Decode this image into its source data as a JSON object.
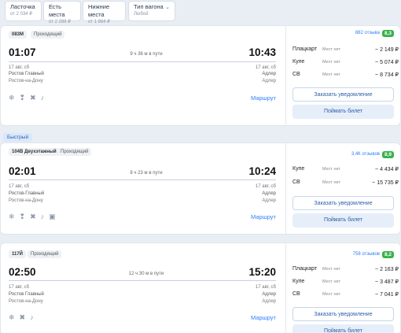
{
  "filters": [
    {
      "title": "Ласточка",
      "sub": "от 2 034 ₽"
    },
    {
      "title": "Есть места",
      "sub": "от 2 288 ₽"
    },
    {
      "title": "Нижние места",
      "sub": "от 1 864 ₽"
    },
    {
      "title": "Тип вагона",
      "sub": "Любой"
    }
  ],
  "fast_label": "Быстрый",
  "common": {
    "route_label": "Маршрут",
    "notify_label": "Заказать уведомление",
    "catch_label": "Поймать билет",
    "no_seats": "Мест нет"
  },
  "trains": [
    {
      "number": "083М",
      "kind": "Проходящий",
      "dep_time": "01:07",
      "arr_time": "10:43",
      "duration": "9 ч 36 м в пути",
      "dep_date": "17 авг, сб",
      "arr_date": "17 авг, сб",
      "dep_station": "Ростов Главный",
      "dep_city": "Ростов-на-Дону",
      "arr_station": "Адлер",
      "arr_city": "Адлер",
      "reviews": "882 отзыва",
      "rating": "8,3",
      "classes": [
        {
          "name": "Плацкарт",
          "price": "~ 2 149 ₽"
        },
        {
          "name": "Купе",
          "price": "~ 5 074 ₽"
        },
        {
          "name": "СВ",
          "price": "~ 8 734 ₽"
        }
      ]
    },
    {
      "number": "104В Двухэтажный",
      "kind": "Проходящий",
      "dep_time": "02:01",
      "arr_time": "10:24",
      "duration": "8 ч 23 м в пути",
      "dep_date": "17 авг, сб",
      "arr_date": "17 авг, сб",
      "dep_station": "Ростов-Главный",
      "dep_city": "Ростов-на-Дону",
      "arr_station": "Адлер",
      "arr_city": "Адлер",
      "reviews": "3,4К отзывов",
      "rating": "8,9",
      "classes": [
        {
          "name": "Купе",
          "price": "~ 4 434 ₽"
        },
        {
          "name": "СВ",
          "price": "~ 15 735 ₽"
        }
      ]
    },
    {
      "number": "117Й",
      "kind": "Проходящий",
      "dep_time": "02:50",
      "arr_time": "15:20",
      "duration": "12 ч 30 м в пути",
      "dep_date": "17 авг, сб",
      "arr_date": "17 авг, сб",
      "dep_station": "Ростов Главный",
      "dep_city": "Ростов-на-Дону",
      "arr_station": "Адлер",
      "arr_city": "Адлер",
      "reviews": "758 отзывов",
      "rating": "8,2",
      "classes": [
        {
          "name": "Плацкарт",
          "price": "~ 2 163 ₽"
        },
        {
          "name": "Купе",
          "price": "~ 3 487 ₽"
        },
        {
          "name": "СВ",
          "price": "~ 7 041 ₽"
        }
      ]
    }
  ]
}
